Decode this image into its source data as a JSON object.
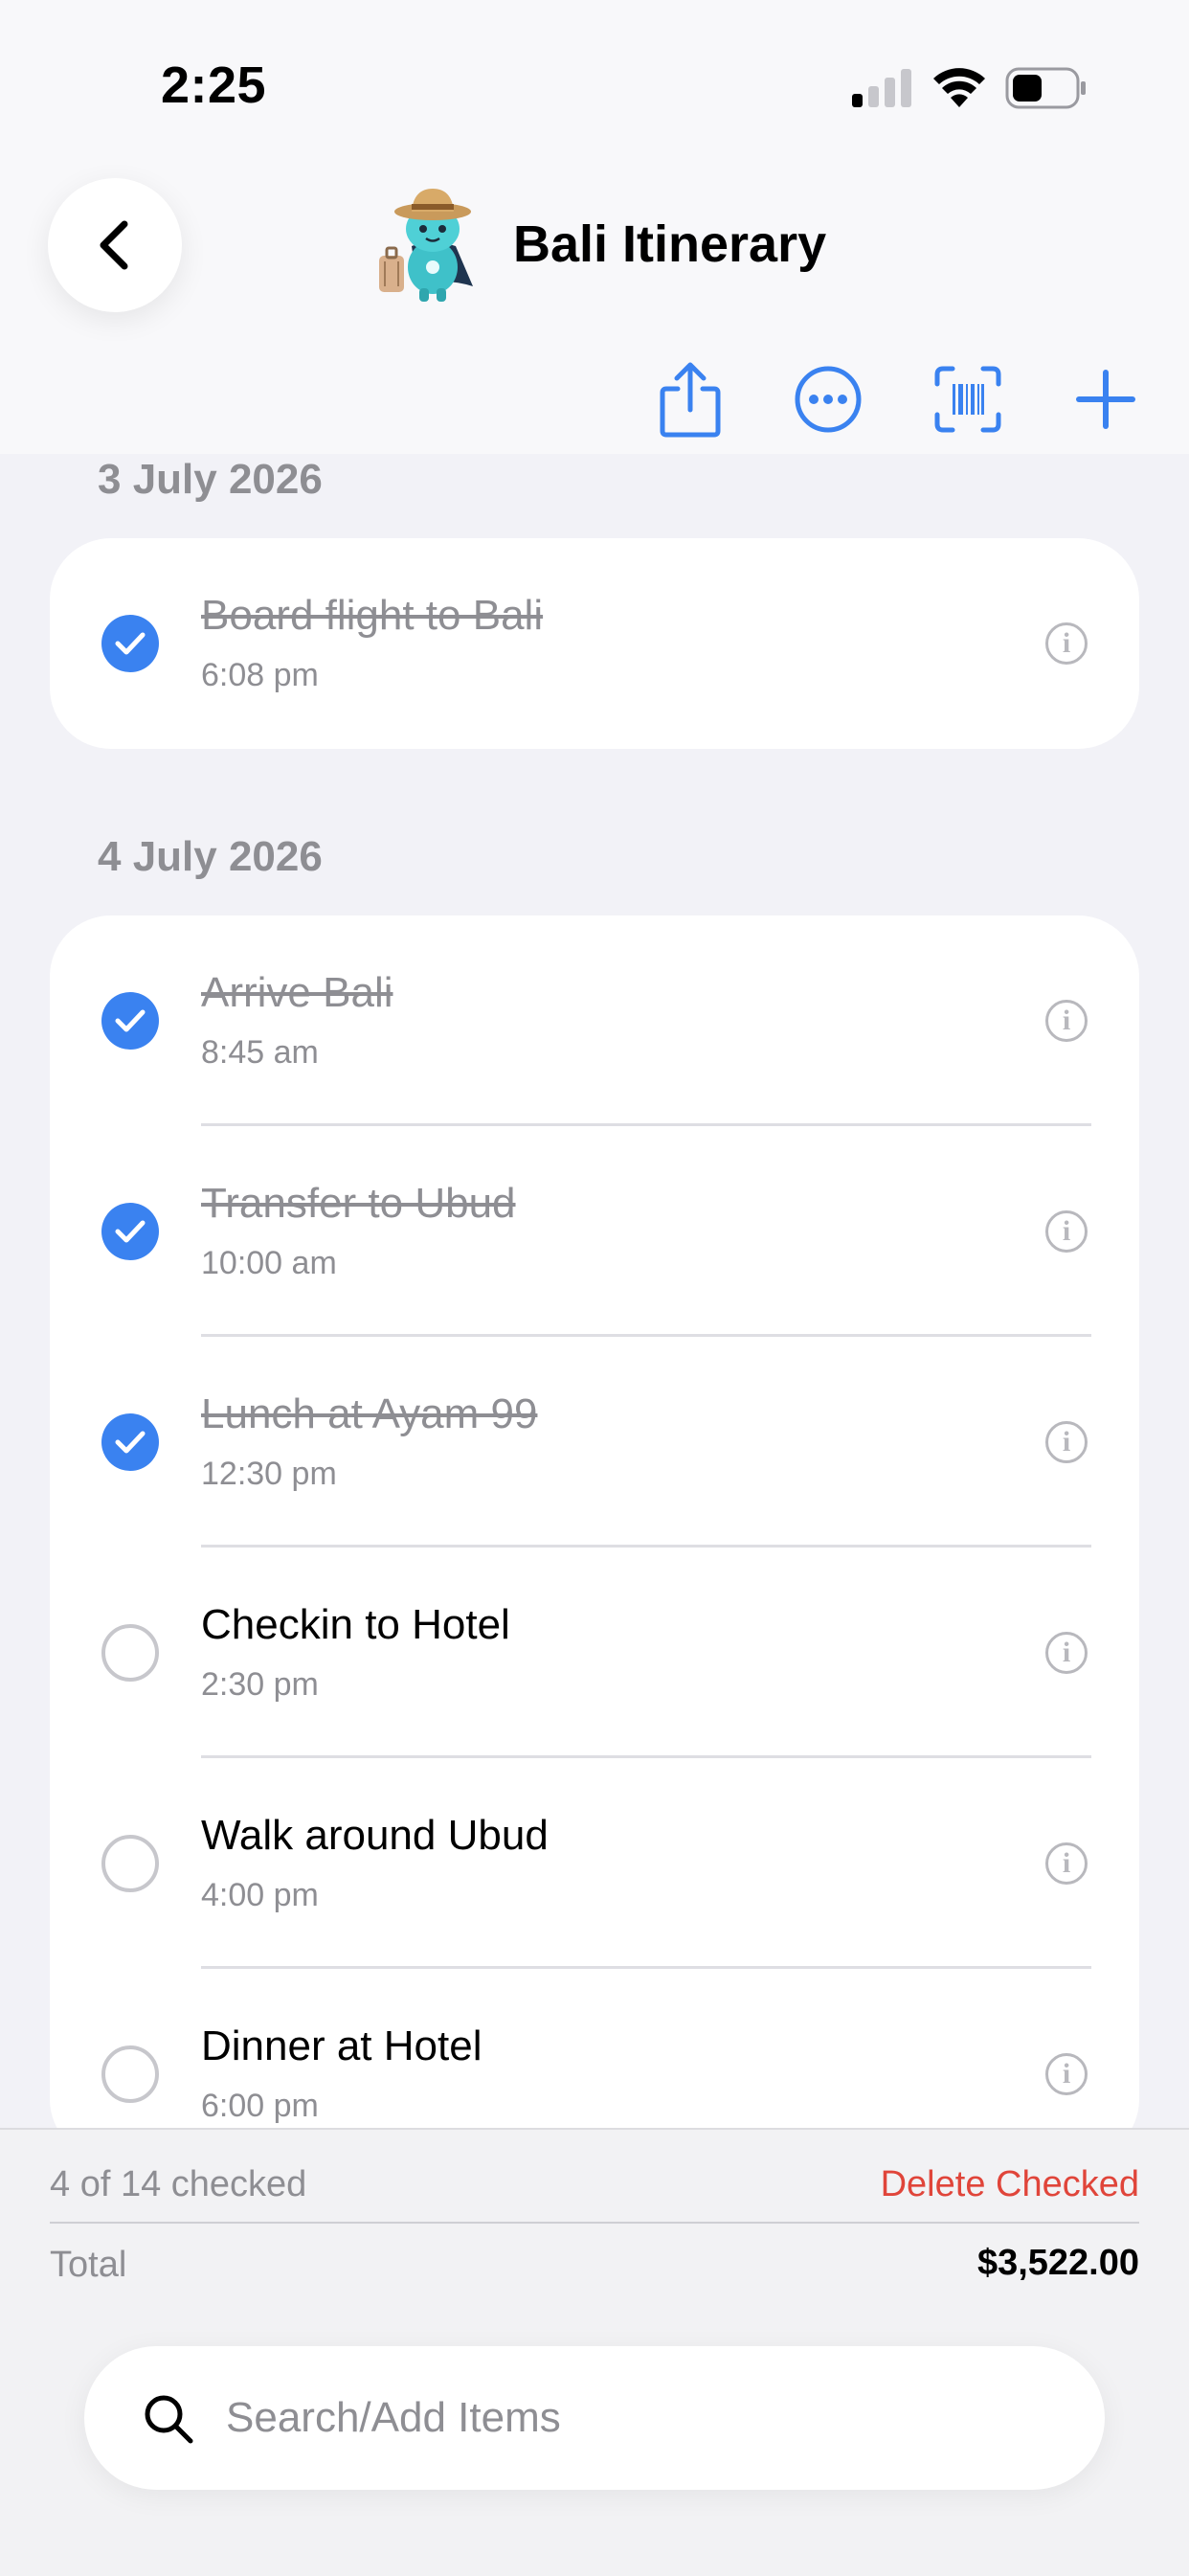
{
  "status_bar": {
    "time": "2:25"
  },
  "header": {
    "title": "Bali Itinerary",
    "back_icon": "chevron-left-icon",
    "avatar_icon": "traveler-mascot-icon",
    "toolbar": [
      {
        "name": "share-button",
        "icon": "share-icon"
      },
      {
        "name": "more-button",
        "icon": "ellipsis-circle-icon"
      },
      {
        "name": "scan-button",
        "icon": "barcode-scan-icon"
      },
      {
        "name": "add-button",
        "icon": "plus-icon"
      }
    ]
  },
  "sections": [
    {
      "date": "3 July 2026",
      "items": [
        {
          "title": "Board flight to Bali",
          "time": "6:08 pm",
          "checked": true
        }
      ]
    },
    {
      "date": "4 July 2026",
      "items": [
        {
          "title": "Arrive Bali",
          "time": "8:45 am",
          "checked": true
        },
        {
          "title": "Transfer to Ubud",
          "time": "10:00 am",
          "checked": true
        },
        {
          "title": "Lunch at Ayam 99",
          "time": "12:30 pm",
          "checked": true
        },
        {
          "title": "Checkin to Hotel",
          "time": "2:30 pm",
          "checked": false
        },
        {
          "title": "Walk around Ubud",
          "time": "4:00 pm",
          "checked": false
        },
        {
          "title": "Dinner at Hotel",
          "time": "6:00 pm",
          "checked": false
        }
      ]
    }
  ],
  "summary": {
    "checked_text": "4 of 14 checked",
    "delete_label": "Delete Checked",
    "total_label": "Total",
    "total_value": "$3,522.00"
  },
  "search": {
    "placeholder": "Search/Add Items"
  },
  "colors": {
    "accent": "#3a82f0",
    "destructive": "#e0453a",
    "secondary_text": "#8e8e93"
  }
}
